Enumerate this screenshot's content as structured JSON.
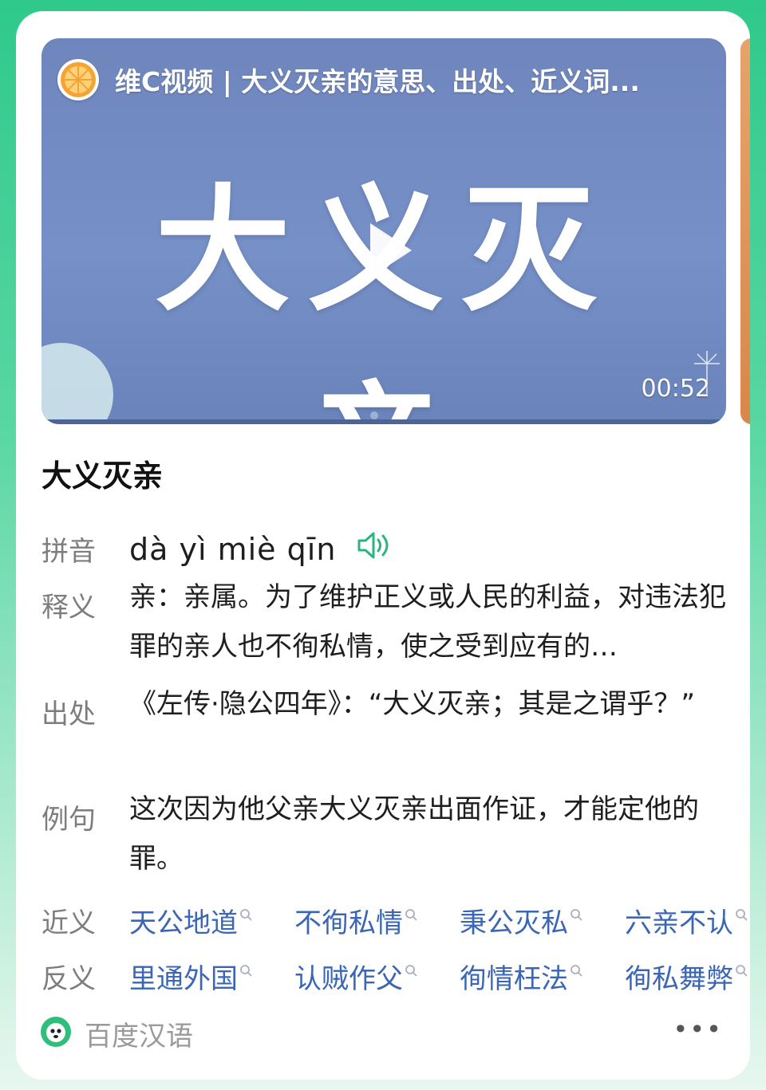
{
  "video": {
    "title": "维C视频 | 大义灭亲的意思、出处、近义词...",
    "overlay_text": "大义灭亲",
    "duration": "00:52",
    "logo_icon": "orange-slice-icon",
    "play_icon": "play-icon"
  },
  "entry": {
    "title": "大义灭亲",
    "rows": {
      "pinyin": {
        "label": "拼音",
        "value": "dà yì miè qīn",
        "icon": "speaker-icon"
      },
      "meaning": {
        "label": "释义",
        "value": "亲：亲属。为了维护正义或人民的利益，对违法犯罪的亲人也不徇私情，使之受到应有的…"
      },
      "source": {
        "label": "出处",
        "value": "《左传·隐公四年》：“大义灭亲；其是之谓乎？”"
      },
      "example": {
        "label": "例句",
        "value": "这次因为他父亲大义灭亲出面作证，才能定他的罪。"
      },
      "synonyms": {
        "label": "近义",
        "items": [
          "天公地道",
          "不徇私情",
          "秉公灭私",
          "六亲不认"
        ]
      },
      "antonyms": {
        "label": "反义",
        "items": [
          "里通外国",
          "认贼作父",
          "徇情枉法",
          "徇私舞弊"
        ]
      }
    }
  },
  "footer": {
    "source": "百度汉语",
    "more": "•••",
    "icon": "baidu-hanyu-icon"
  },
  "colors": {
    "accent": "#2fc98b",
    "link": "#3a66b5",
    "label": "#7d7d7d"
  }
}
